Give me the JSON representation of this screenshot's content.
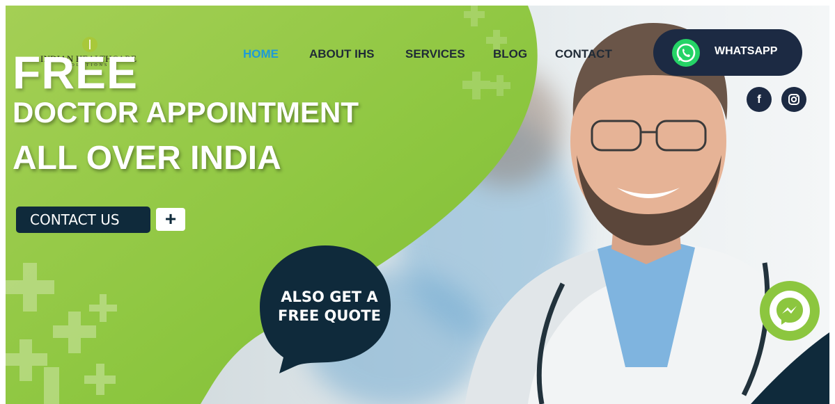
{
  "logo": {
    "name": "INDIAN HEALTHCARE",
    "sub": "SOLUTIONS"
  },
  "nav": {
    "items": [
      {
        "label": "HOME",
        "active": true
      },
      {
        "label": "ABOUT IHS",
        "active": false
      },
      {
        "label": "SERVICES",
        "active": false
      },
      {
        "label": "BLOG",
        "active": false
      },
      {
        "label": "CONTACT",
        "active": false
      }
    ]
  },
  "whatsapp": {
    "label": "WHATSAPP",
    "icon": "whatsapp-icon"
  },
  "social": [
    {
      "icon": "facebook-icon",
      "glyph": "f"
    },
    {
      "icon": "instagram-icon",
      "glyph": "◎"
    }
  ],
  "hero": {
    "line1": "FREE",
    "line2": "DOCTOR APPOINTMENT",
    "line3": "ALL OVER INDIA",
    "cta_label": "CONTACT US",
    "cta_plus": "+",
    "quote_line1": "ALSO GET A",
    "quote_line2": "FREE QUOTE"
  },
  "colors": {
    "accent_green": "#8cc63f",
    "navy": "#1c2a43",
    "nav_active": "#1e9bd7"
  }
}
